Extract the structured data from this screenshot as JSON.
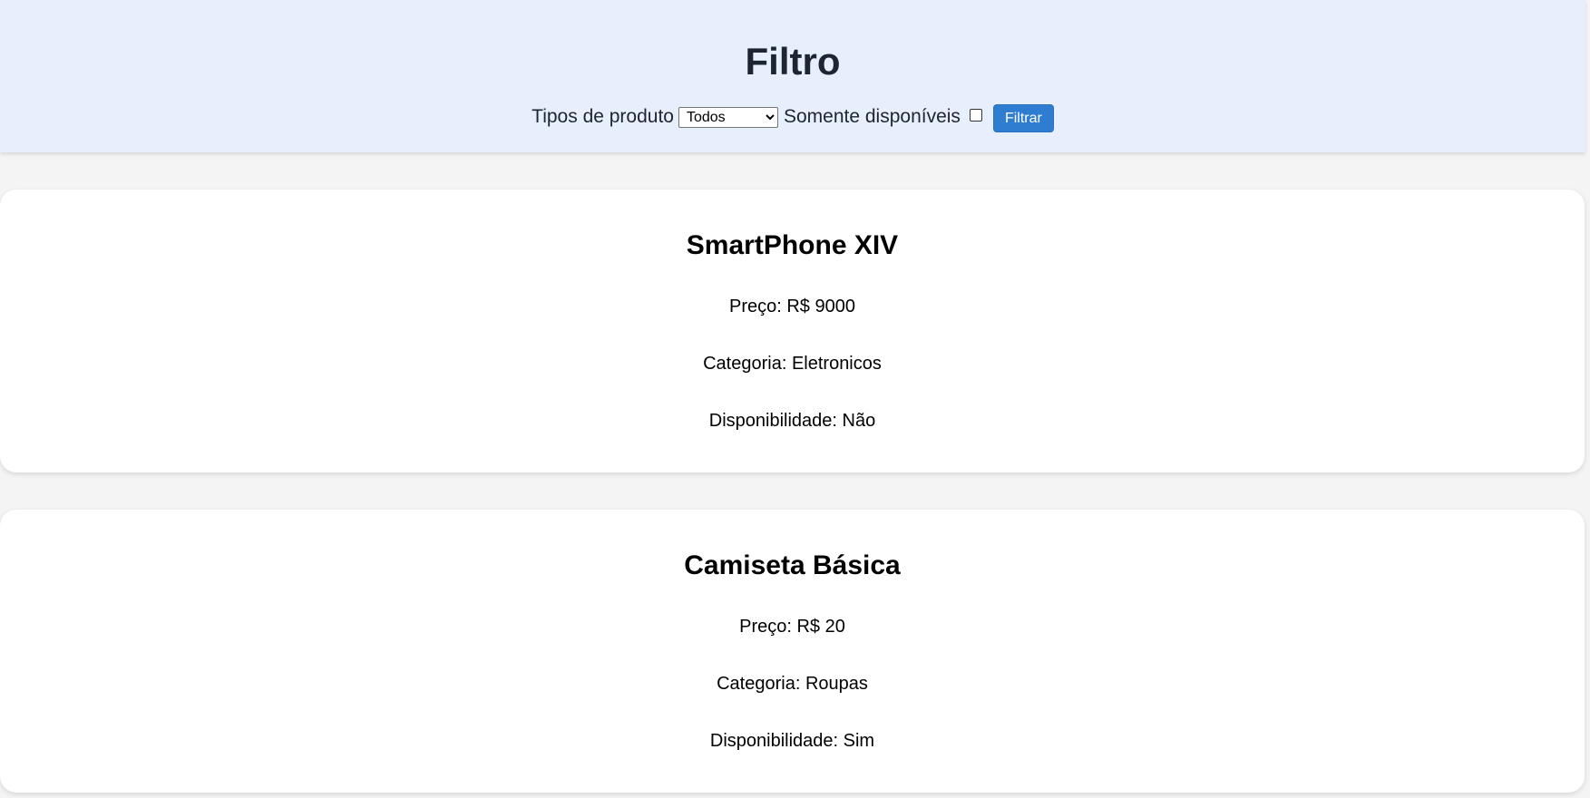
{
  "filter": {
    "title": "Filtro",
    "type_label": "Tipos de produto",
    "type_selected": "Todos",
    "only_available_label": "Somente disponíveis",
    "only_available_checked": false,
    "button_label": "Filtrar",
    "button_color": "#2f7dd1",
    "header_bg": "#e6effb"
  },
  "products": [
    {
      "name": "SmartPhone XIV",
      "price": "Preço: R$ 9000",
      "category": "Categoria: Eletronicos",
      "availability": "Disponibilidade: Não"
    },
    {
      "name": "Camiseta Básica",
      "price": "Preço: R$ 20",
      "category": "Categoria: Roupas",
      "availability": "Disponibilidade: Sim"
    }
  ]
}
